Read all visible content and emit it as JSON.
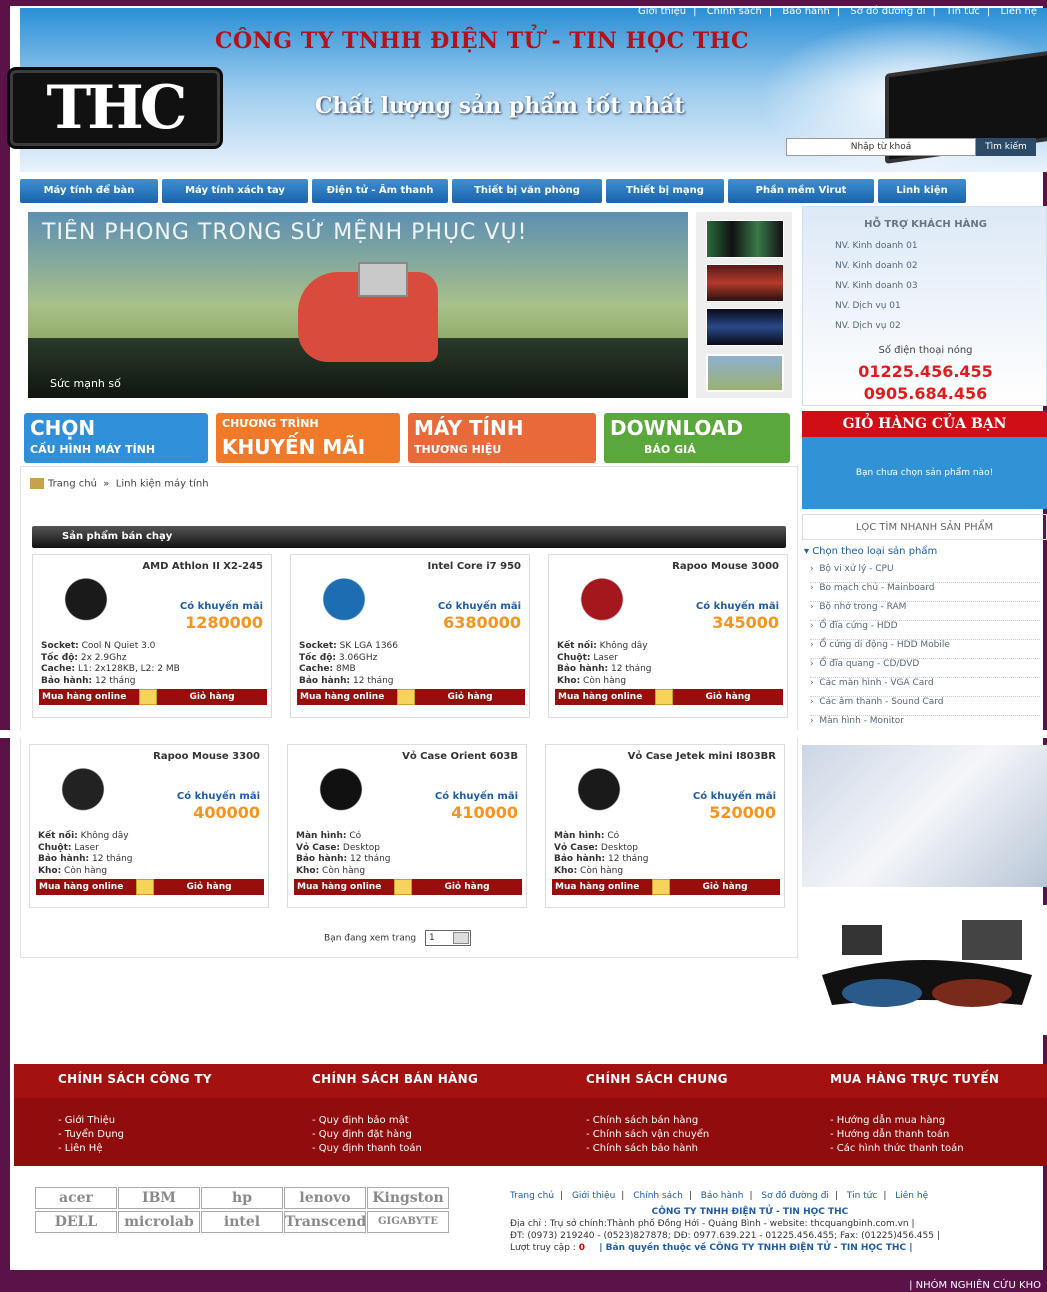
{
  "header": {
    "top_links": [
      "Giới thiệu",
      "Chính sách",
      "Bảo hành",
      "Sơ đồ đường đi",
      "Tin tức",
      "Liên hệ"
    ],
    "company": "CÔNG TY TNHH ĐIỆN TỬ - TIN HỌC THC",
    "logo": "THC",
    "slogan": "Chất lượng sản phẩm tốt nhất",
    "search_placeholder": "Nhập từ khoá",
    "search_button": "Tìm kiếm"
  },
  "nav": [
    "Máy tính để bàn",
    "Máy tính xách tay",
    "Điện tử - Âm thanh",
    "Thiết bị văn phòng",
    "Thiết bị mạng",
    "Phần mềm Virut",
    "Linh kiện"
  ],
  "banner": {
    "title": "TIÊN PHONG TRONG SỨ MỆNH PHỤC VỤ!",
    "caption": "Sức mạnh số"
  },
  "promos": [
    {
      "l1": "CHỌN",
      "l2": "CẤU HÌNH MÁY TÍNH",
      "color": "#2f8fd8"
    },
    {
      "l1": "KHUYẾN MÃI",
      "l2": "CHƯƠNG TRÌNH",
      "color": "#f07a2a"
    },
    {
      "l1": "MÁY TÍNH",
      "l2": "THƯƠNG HIỆU",
      "color": "#e86a3a"
    },
    {
      "l1": "DOWNLOAD",
      "l2": "BÁO GIÁ",
      "color": "#5aa83c"
    }
  ],
  "support": {
    "title": "HỖ TRỢ KHÁCH HÀNG",
    "staff": [
      "NV. Kinh doanh 01",
      "NV. Kinh doanh 02",
      "NV. Kinh doanh 03",
      "NV. Dịch vụ 01",
      "NV. Dịch vụ 02"
    ],
    "hotline_label": "Số điện thoại nóng",
    "phone1": "01225.456.455",
    "phone2": "0905.684.456"
  },
  "cart": {
    "title": "GIỎ HÀNG CỦA BẠN",
    "empty": "Bạn chưa chọn sản phẩm nào!"
  },
  "filter": {
    "title": "LỌC TÌM NHANH SẢN PHẨM",
    "select": "Chọn theo loại sản phẩm",
    "items": [
      "Bộ vi xử lý - CPU",
      "Bo mạch chủ - Mainboard",
      "Bộ nhớ trong - RAM",
      "Ổ đĩa cứng - HDD",
      "Ổ cứng di động - HDD Mobile",
      "Ổ đĩa quang - CD/DVD",
      "Các màn hình - VGA Card",
      "Các âm thanh - Sound Card",
      "Màn hình - Monitor"
    ]
  },
  "breadcrumb": {
    "home": "Trang chủ",
    "sep": "»",
    "current": "Linh kiện máy tính"
  },
  "hot_title": "Sản phẩm bán chạy",
  "product_labels": {
    "promo": "Có khuyến mãi",
    "buy": "Mua hàng online",
    "cart": "Giỏ hàng"
  },
  "products": [
    {
      "name": "AMD Athlon II X2-245",
      "price": "1280000",
      "specs": [
        [
          "Socket:",
          "Cool N Quiet 3.0"
        ],
        [
          "Tốc độ:",
          "2x 2.9Ghz"
        ],
        [
          "Cache:",
          "L1: 2x128KB, L2: 2 MB"
        ],
        [
          "Bảo hành:",
          "12 tháng"
        ]
      ],
      "img": "#1a1a1a"
    },
    {
      "name": "Intel Core i7 950",
      "price": "6380000",
      "specs": [
        [
          "Socket:",
          "SK LGA 1366"
        ],
        [
          "Tốc độ:",
          "3.06GHz"
        ],
        [
          "Cache:",
          "8MB"
        ],
        [
          "Bảo hành:",
          "12 tháng"
        ]
      ],
      "img": "#1d6db3"
    },
    {
      "name": "Rapoo Mouse 3000",
      "price": "345000",
      "specs": [
        [
          "Kết nối:",
          "Không dây"
        ],
        [
          "Chuột:",
          "Laser"
        ],
        [
          "Bảo hành:",
          "12 tháng"
        ],
        [
          "Kho:",
          "Còn hàng"
        ]
      ],
      "img": "#a3171d"
    },
    {
      "name": "Rapoo Mouse 3300",
      "price": "400000",
      "specs": [
        [
          "Kết nối:",
          "Không dây"
        ],
        [
          "Chuột:",
          "Laser"
        ],
        [
          "Bảo hành:",
          "12 tháng"
        ],
        [
          "Kho:",
          "Còn hàng"
        ]
      ],
      "img": "#222"
    },
    {
      "name": "Vỏ Case Orient 603B",
      "price": "410000",
      "specs": [
        [
          "Màn hình:",
          "Có"
        ],
        [
          "Vỏ Case:",
          "Desktop"
        ],
        [
          "Bảo hành:",
          "12 tháng"
        ],
        [
          "Kho:",
          "Còn hàng"
        ]
      ],
      "img": "#111"
    },
    {
      "name": "Vỏ Case Jetek mini I803BR",
      "price": "520000",
      "specs": [
        [
          "Màn hình:",
          "Có"
        ],
        [
          "Vỏ Case:",
          "Desktop"
        ],
        [
          "Bảo hành:",
          "12 tháng"
        ],
        [
          "Kho:",
          "Còn hàng"
        ]
      ],
      "img": "#1a1a1a"
    }
  ],
  "pager": {
    "label": "Bạn đang xem trang",
    "value": "1"
  },
  "footer": {
    "cols": [
      {
        "title": "CHÍNH SÁCH CÔNG TY",
        "items": [
          "- Giới Thiệu",
          "- Tuyển Dụng",
          "- Liên Hệ"
        ]
      },
      {
        "title": "CHÍNH SÁCH BÁN HÀNG",
        "items": [
          "- Quy định bảo mật",
          "- Quy định đặt hàng",
          "- Quy định thanh toán"
        ]
      },
      {
        "title": "CHÍNH SÁCH CHUNG",
        "items": [
          "- Chính sách bán hàng",
          "- Chính sách vận chuyển",
          "- Chính sách bảo hành"
        ]
      },
      {
        "title": "MUA HÀNG TRỰC TUYẾN",
        "items": [
          "- Hướng dẫn mua hàng",
          "- Hướng dẫn thanh toán",
          "- Các hình thức thanh toán"
        ]
      }
    ],
    "brands": [
      "acer",
      "IBM",
      "hp",
      "lenovo",
      "Kingston",
      "DELL",
      "microlab",
      "intel",
      "Transcend",
      "GIGABYTE"
    ],
    "links": [
      "Trang chủ",
      "Giới thiệu",
      "Chính sách",
      "Bảo hành",
      "Sơ đồ đường đi",
      "Tin tức",
      "Liên hệ"
    ],
    "company": "CÔNG TY TNHH ĐIỆN TỬ - TIN HỌC THC",
    "address": "Địa chỉ : Trụ sở chính:Thành phố Đồng Hới - Quảng Bình - website: thcquangbinh.com.vn |",
    "contact": "ĐT: (0973) 219240 - (0523)827878; DĐ: 0977.639.221 - 01225.456.455; Fax: (01225)456.455 |",
    "visits_label": "Lượt truy cập :",
    "visits": "0",
    "copyright": "| Bản quyền thuộc về CÔNG TY TNHH ĐIỆN TỬ - TIN HỌC THC |",
    "bottom": "| NHÓM NGHIÊN CỨU KHO"
  }
}
